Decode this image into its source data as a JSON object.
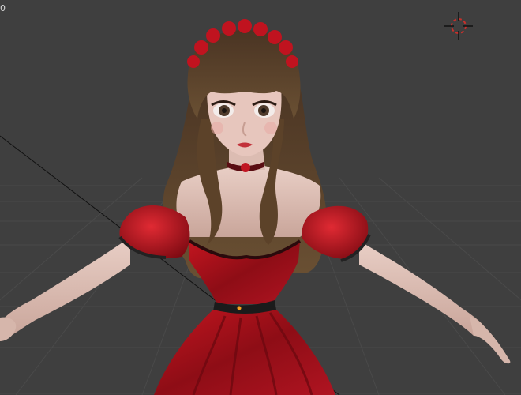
{
  "viewport": {
    "corner_text": "0",
    "background": "#3f3f3f",
    "grid_color": "#4a4a4a",
    "cursor_color": "#c8302b"
  },
  "scene_objects": [
    {
      "name": "character-model",
      "icon": "character-figure"
    },
    {
      "name": "3d-cursor",
      "icon": "crosshair-icon"
    },
    {
      "name": "origin-point",
      "icon": "dot-icon"
    }
  ]
}
